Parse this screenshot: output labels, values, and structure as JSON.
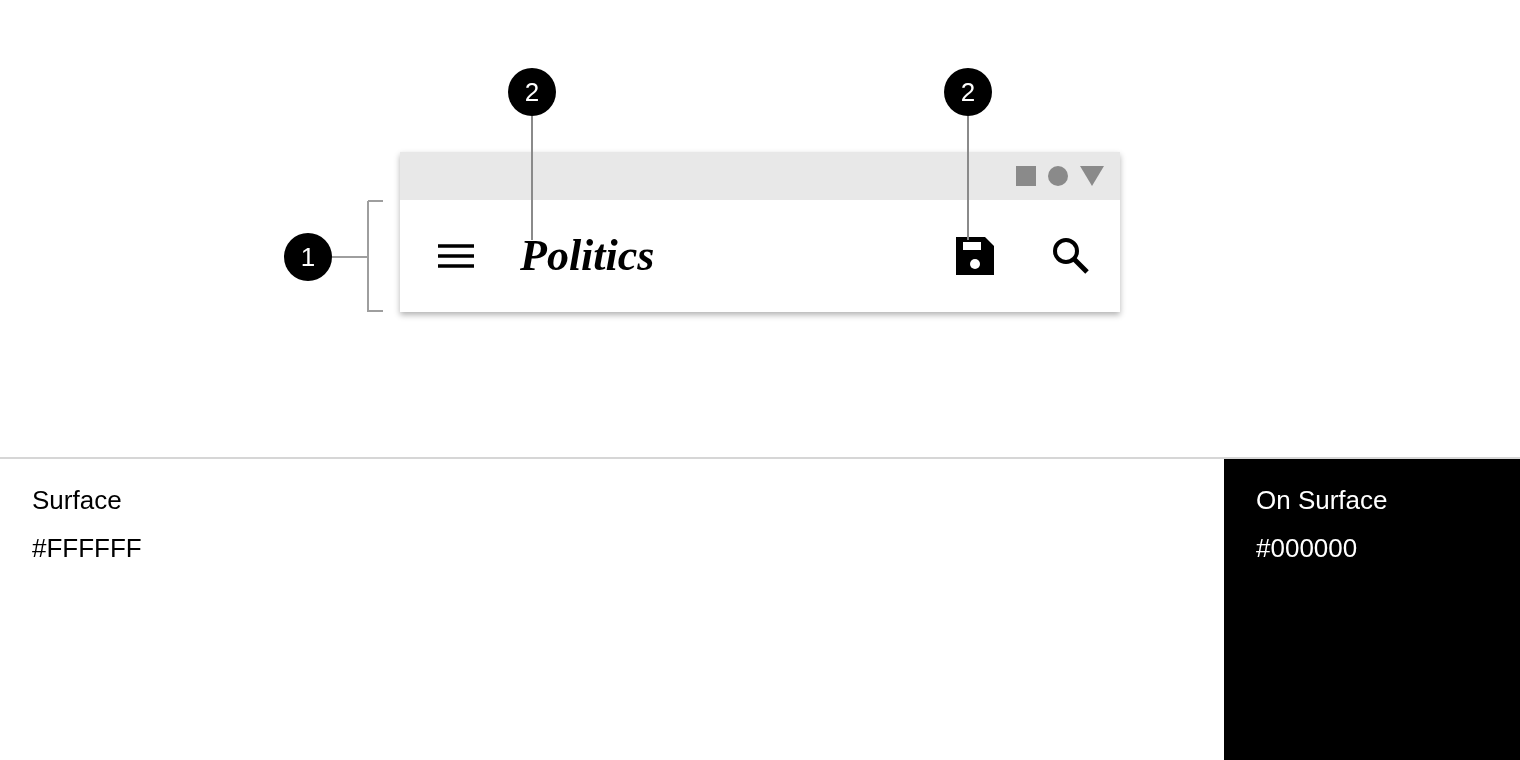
{
  "app_bar": {
    "title": "Politics"
  },
  "markers": [
    {
      "label": "1",
      "kind": "bracket"
    },
    {
      "label": "2",
      "kind": "pointer"
    },
    {
      "label": "2",
      "kind": "pointer"
    }
  ],
  "swatches": [
    {
      "name": "Surface",
      "hex": "#FFFFFF",
      "color": "#ffffff"
    },
    {
      "name": "On Surface",
      "hex": "#000000",
      "color": "#000000"
    }
  ]
}
